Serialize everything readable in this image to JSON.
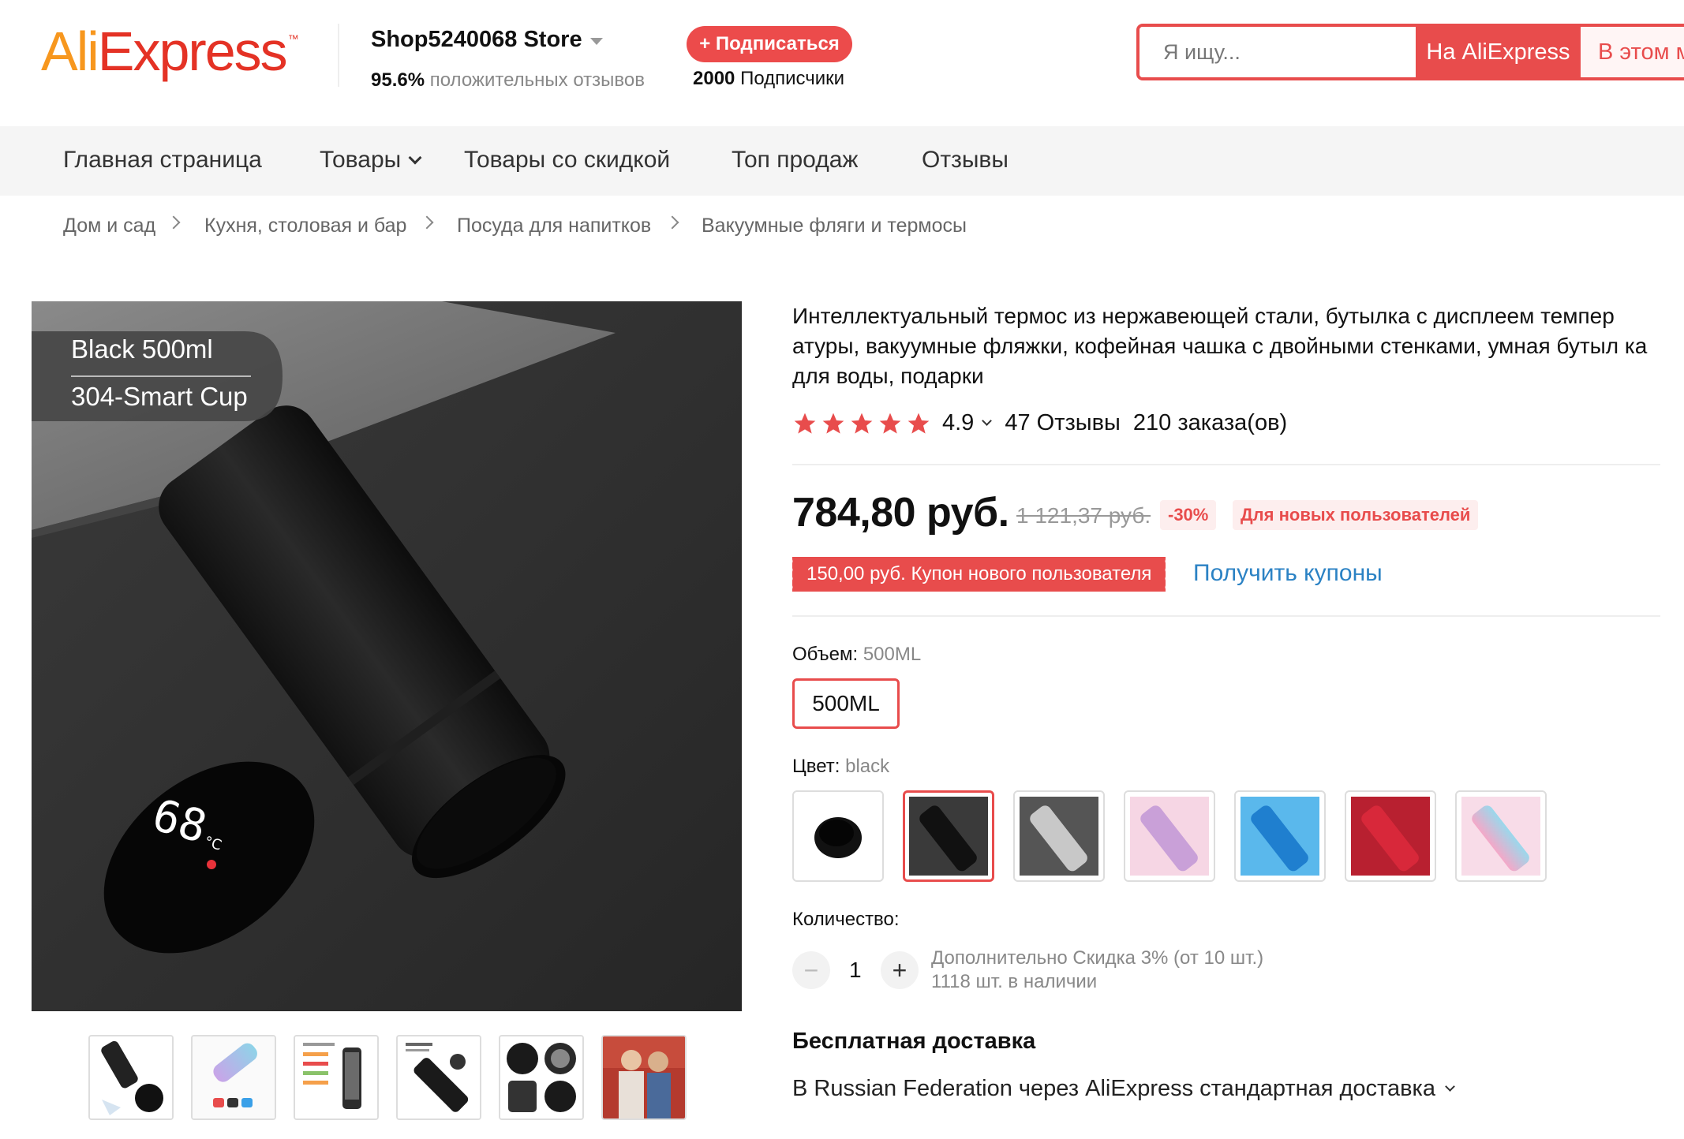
{
  "header": {
    "logo_text": "AliExpress",
    "store_name": "Shop5240068 Store",
    "positive_percent": "95.6%",
    "positive_label": "положительных отзывов",
    "follow_label": "+ Подписаться",
    "followers_count": "2000",
    "followers_label": "Подписчики",
    "search_placeholder": "Я ищу...",
    "search_on_ali": "На AliExpress",
    "search_in_store": "В этом м"
  },
  "nav": {
    "items": [
      {
        "label": "Главная страница"
      },
      {
        "label": "Товары"
      },
      {
        "label": "Товары со скидкой"
      },
      {
        "label": "Топ продаж"
      },
      {
        "label": "Отзывы"
      }
    ]
  },
  "breadcrumb": [
    "Дом и сад",
    "Кухня, столовая и бар",
    "Посуда для напитков",
    "Вакуумные фляги и термосы"
  ],
  "gallery": {
    "badge_line1": "Black 500ml",
    "badge_line2": "304-Smart Cup",
    "display_temp": "68",
    "display_unit": "°C"
  },
  "product": {
    "title": "Интеллектуальный термос из нержавеющей стали, бутылка с дисплеем темпер атуры, вакуумные фляжки, кофейная чашка с двойными стенками, умная бутыл ка для воды, подарки",
    "rating": "4.9",
    "reviews": "47 Отзывы",
    "orders": "210 заказа(ов)",
    "star_color": "#e84c4c",
    "price": "784,80 руб.",
    "old_price": "1 121,37 руб.",
    "discount": "-30%",
    "new_users_label": "Для новых пользователей",
    "coupon_label": "150,00 руб. Купон нового пользователя",
    "get_coupons": "Получить купоны",
    "volume_label": "Объем:",
    "volume_value": "500ML",
    "volume_option": "500ML",
    "color_label": "Цвет:",
    "color_value": "black",
    "quantity_label": "Количество:",
    "quantity_value": "1",
    "qty_minus": "−",
    "qty_plus": "+",
    "extra_discount": "Дополнительно Скидка 3% (от 10 шт.)",
    "in_stock": "1118 шт. в наличии",
    "shipping_title": "Бесплатная доставка",
    "shipping_line": "В Russian Federation через AliExpress стандартная доставка"
  },
  "colors": {
    "accent": "#e84c4c",
    "link": "#2b82c4"
  }
}
